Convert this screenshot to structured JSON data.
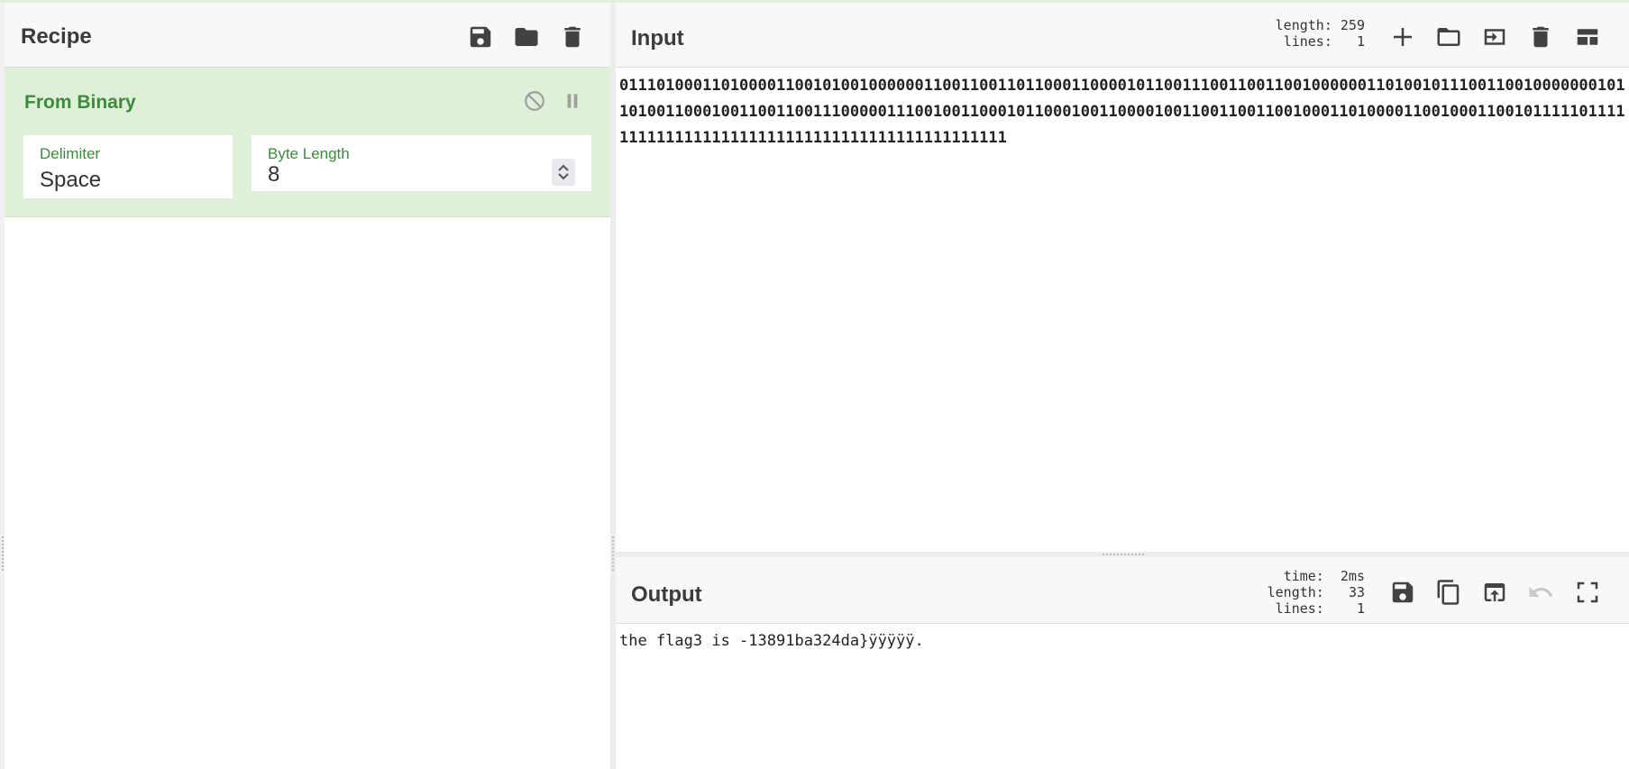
{
  "recipe": {
    "title": "Recipe",
    "icons": [
      "save-icon",
      "folder-icon",
      "trash-icon"
    ],
    "operation": {
      "name": "From Binary",
      "fields": [
        {
          "label": "Delimiter",
          "value": "Space"
        },
        {
          "label": "Byte Length",
          "value": "8"
        }
      ],
      "controls": [
        "disable-icon",
        "pause-icon"
      ]
    }
  },
  "input": {
    "title": "Input",
    "stats": {
      "length_label": "length:",
      "length": "259",
      "lines_label": "lines:",
      "lines": "1"
    },
    "text": "01110100011010000110010100100000011001100110110001100001011001110011001100100000011010010111001100100000001011010011000100110011001110000011100100110001011000100110000100110011001100100011010000110010001100101111101111111111111111111111111111111111111111111111",
    "icons": [
      "add-icon",
      "open-folder-icon",
      "import-icon",
      "trash-icon",
      "layout-icon"
    ]
  },
  "output": {
    "title": "Output",
    "stats": {
      "time_label": "time:",
      "time": "2ms",
      "length_label": "length:",
      "length": "33",
      "lines_label": "lines:",
      "lines": "1"
    },
    "text": "the flag3 is -13891ba324da}ÿÿÿÿÿ.",
    "icons": [
      "save-icon",
      "copy-icon",
      "replace-input-icon",
      "undo-icon",
      "maximize-icon"
    ]
  }
}
